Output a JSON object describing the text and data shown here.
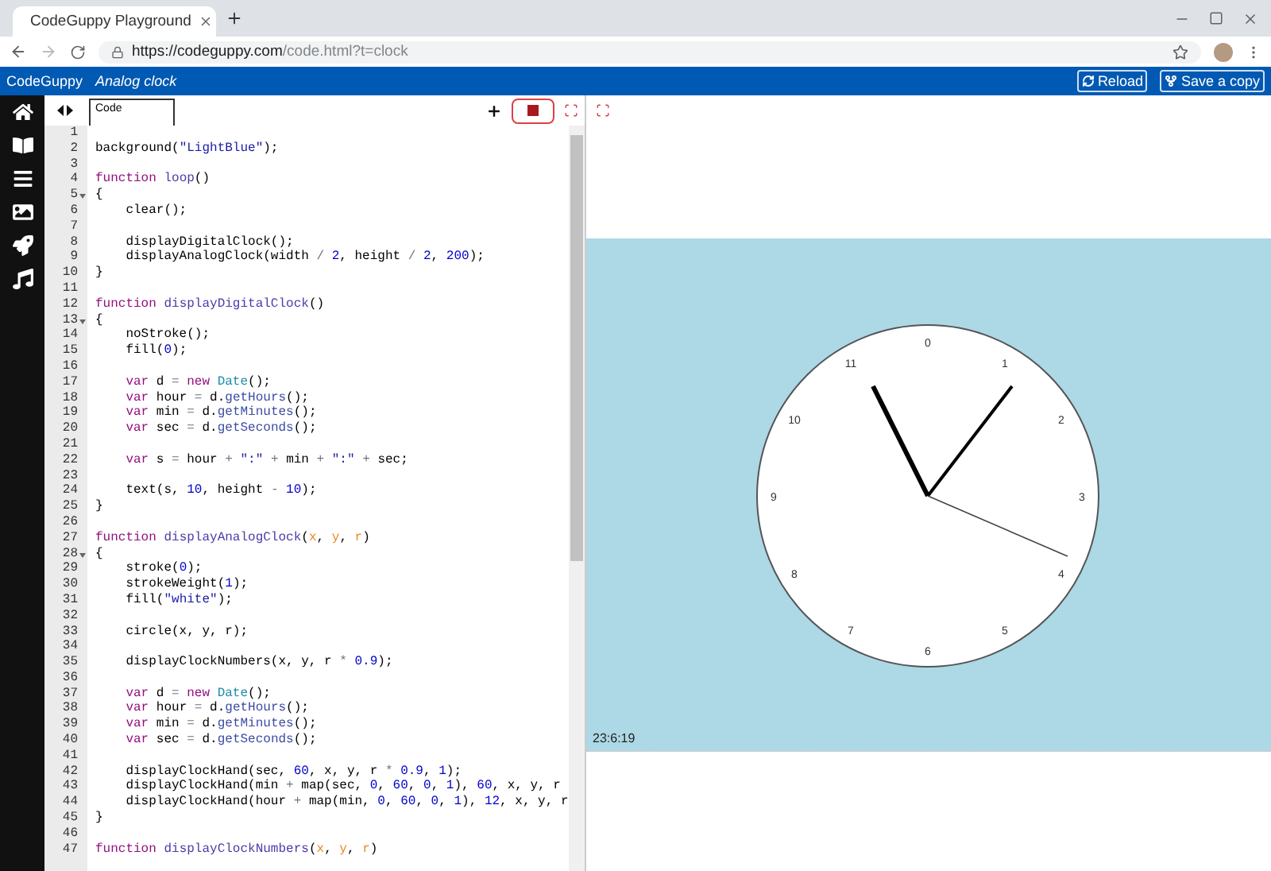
{
  "browser": {
    "tab": {
      "title": "CodeGuppy Playground"
    },
    "url": {
      "host": "https://codeguppy.com",
      "path": "/code.html?t=clock"
    }
  },
  "app_bar": {
    "brand": "CodeGuppy",
    "project": "Analog clock",
    "buttons": [
      {
        "label": "Reload",
        "kind": "reload"
      },
      {
        "label": "Save a copy",
        "kind": "fork"
      }
    ]
  },
  "sidebar": {
    "items": [
      {
        "kind": "home"
      },
      {
        "kind": "book"
      },
      {
        "kind": "list"
      },
      {
        "kind": "image"
      },
      {
        "kind": "rocket"
      },
      {
        "kind": "music"
      }
    ]
  },
  "editor": {
    "tabs": [
      {
        "label": "Code",
        "selected": true
      }
    ],
    "running": true,
    "lines": [
      {
        "n": "1",
        "fold": false
      },
      {
        "n": "2",
        "fold": false,
        "indented": false,
        "tokens": [
          {
            "kind": "plain",
            "text": "background("
          },
          {
            "kind": "string",
            "text": "\"LightBlue\""
          },
          {
            "kind": "plain",
            "text": ");"
          }
        ]
      },
      {
        "n": "3",
        "fold": false
      },
      {
        "n": "4",
        "fold": false,
        "indented": false,
        "tokens": [
          {
            "kind": "keyword",
            "text": "function "
          },
          {
            "kind": "def",
            "text": "loop"
          },
          {
            "kind": "plain",
            "text": "()"
          }
        ]
      },
      {
        "n": "5",
        "fold": true,
        "indented": false,
        "tokens": [
          {
            "kind": "plain",
            "text": "{"
          }
        ]
      },
      {
        "n": "6",
        "fold": false,
        "indented": true,
        "tokens": [
          {
            "kind": "plain",
            "text": "clear();"
          }
        ]
      },
      {
        "n": "7",
        "fold": false
      },
      {
        "n": "8",
        "fold": false,
        "indented": true,
        "tokens": [
          {
            "kind": "plain",
            "text": "displayDigitalClock();"
          }
        ]
      },
      {
        "n": "9",
        "fold": false,
        "indented": true,
        "tokens": [
          {
            "kind": "plain",
            "text": "displayAnalogClock(width "
          },
          {
            "kind": "operator",
            "text": "/ "
          },
          {
            "kind": "number",
            "text": "2"
          },
          {
            "kind": "plain",
            "text": ", height "
          },
          {
            "kind": "operator",
            "text": "/ "
          },
          {
            "kind": "number",
            "text": "2"
          },
          {
            "kind": "plain",
            "text": ", "
          },
          {
            "kind": "number",
            "text": "200"
          },
          {
            "kind": "plain",
            "text": ");"
          }
        ]
      },
      {
        "n": "10",
        "fold": false,
        "indented": false,
        "tokens": [
          {
            "kind": "plain",
            "text": "}"
          }
        ]
      },
      {
        "n": "11",
        "fold": false
      },
      {
        "n": "12",
        "fold": false,
        "indented": false,
        "tokens": [
          {
            "kind": "keyword",
            "text": "function "
          },
          {
            "kind": "def",
            "text": "displayDigitalClock"
          },
          {
            "kind": "plain",
            "text": "()"
          }
        ]
      },
      {
        "n": "13",
        "fold": true,
        "indented": false,
        "tokens": [
          {
            "kind": "plain",
            "text": "{"
          }
        ]
      },
      {
        "n": "14",
        "fold": false,
        "indented": true,
        "tokens": [
          {
            "kind": "plain",
            "text": "noStroke();"
          }
        ]
      },
      {
        "n": "15",
        "fold": false,
        "indented": true,
        "tokens": [
          {
            "kind": "plain",
            "text": "fill("
          },
          {
            "kind": "number",
            "text": "0"
          },
          {
            "kind": "plain",
            "text": ");"
          }
        ]
      },
      {
        "n": "16",
        "fold": false
      },
      {
        "n": "17",
        "fold": false,
        "indented": true,
        "tokens": [
          {
            "kind": "keyword",
            "text": "var"
          },
          {
            "kind": "plain",
            "text": " d "
          },
          {
            "kind": "operator",
            "text": "= "
          },
          {
            "kind": "keyword",
            "text": "new "
          },
          {
            "kind": "type",
            "text": "Date"
          },
          {
            "kind": "plain",
            "text": "();"
          }
        ]
      },
      {
        "n": "18",
        "fold": false,
        "indented": true,
        "tokens": [
          {
            "kind": "keyword",
            "text": "var"
          },
          {
            "kind": "plain",
            "text": " hour "
          },
          {
            "kind": "operator",
            "text": "="
          },
          {
            "kind": "plain",
            "text": " d."
          },
          {
            "kind": "method",
            "text": "getHours"
          },
          {
            "kind": "plain",
            "text": "();"
          }
        ]
      },
      {
        "n": "19",
        "fold": false,
        "indented": true,
        "tokens": [
          {
            "kind": "keyword",
            "text": "var"
          },
          {
            "kind": "plain",
            "text": " min "
          },
          {
            "kind": "operator",
            "text": "="
          },
          {
            "kind": "plain",
            "text": " d."
          },
          {
            "kind": "method",
            "text": "getMinutes"
          },
          {
            "kind": "plain",
            "text": "();"
          }
        ]
      },
      {
        "n": "20",
        "fold": false,
        "indented": true,
        "tokens": [
          {
            "kind": "keyword",
            "text": "var"
          },
          {
            "kind": "plain",
            "text": " sec "
          },
          {
            "kind": "operator",
            "text": "="
          },
          {
            "kind": "plain",
            "text": " d."
          },
          {
            "kind": "method",
            "text": "getSeconds"
          },
          {
            "kind": "plain",
            "text": "();"
          }
        ]
      },
      {
        "n": "21",
        "fold": false
      },
      {
        "n": "22",
        "fold": false,
        "indented": true,
        "tokens": [
          {
            "kind": "keyword",
            "text": "var"
          },
          {
            "kind": "plain",
            "text": " s "
          },
          {
            "kind": "operator",
            "text": "="
          },
          {
            "kind": "plain",
            "text": " hour "
          },
          {
            "kind": "operator",
            "text": "+ "
          },
          {
            "kind": "string",
            "text": "\":\""
          },
          {
            "kind": "operator",
            "text": " + "
          },
          {
            "kind": "plain",
            "text": "min "
          },
          {
            "kind": "operator",
            "text": "+ "
          },
          {
            "kind": "string",
            "text": "\":\""
          },
          {
            "kind": "operator",
            "text": " + "
          },
          {
            "kind": "plain",
            "text": "sec;"
          }
        ]
      },
      {
        "n": "23",
        "fold": false
      },
      {
        "n": "24",
        "fold": false,
        "indented": true,
        "tokens": [
          {
            "kind": "plain",
            "text": "text(s, "
          },
          {
            "kind": "number",
            "text": "10"
          },
          {
            "kind": "plain",
            "text": ", height "
          },
          {
            "kind": "operator",
            "text": "- "
          },
          {
            "kind": "number",
            "text": "10"
          },
          {
            "kind": "plain",
            "text": ");"
          }
        ]
      },
      {
        "n": "25",
        "fold": false,
        "indented": false,
        "tokens": [
          {
            "kind": "plain",
            "text": "}"
          }
        ]
      },
      {
        "n": "26",
        "fold": false
      },
      {
        "n": "27",
        "fold": false,
        "indented": false,
        "tokens": [
          {
            "kind": "keyword",
            "text": "function "
          },
          {
            "kind": "def",
            "text": "displayAnalogClock"
          },
          {
            "kind": "plain",
            "text": "("
          },
          {
            "kind": "param",
            "text": "x"
          },
          {
            "kind": "plain",
            "text": ", "
          },
          {
            "kind": "param",
            "text": "y"
          },
          {
            "kind": "plain",
            "text": ", "
          },
          {
            "kind": "param",
            "text": "r"
          },
          {
            "kind": "plain",
            "text": ")"
          }
        ]
      },
      {
        "n": "28",
        "fold": true,
        "indented": false,
        "tokens": [
          {
            "kind": "plain",
            "text": "{"
          }
        ]
      },
      {
        "n": "29",
        "fold": false,
        "indented": true,
        "tokens": [
          {
            "kind": "plain",
            "text": "stroke("
          },
          {
            "kind": "number",
            "text": "0"
          },
          {
            "kind": "plain",
            "text": ");"
          }
        ]
      },
      {
        "n": "30",
        "fold": false,
        "indented": true,
        "tokens": [
          {
            "kind": "plain",
            "text": "strokeWeight("
          },
          {
            "kind": "number",
            "text": "1"
          },
          {
            "kind": "plain",
            "text": ");"
          }
        ]
      },
      {
        "n": "31",
        "fold": false,
        "indented": true,
        "tokens": [
          {
            "kind": "plain",
            "text": "fill("
          },
          {
            "kind": "string",
            "text": "\"white\""
          },
          {
            "kind": "plain",
            "text": ");"
          }
        ]
      },
      {
        "n": "32",
        "fold": false
      },
      {
        "n": "33",
        "fold": false,
        "indented": true,
        "tokens": [
          {
            "kind": "plain",
            "text": "circle(x, y, r);"
          }
        ]
      },
      {
        "n": "34",
        "fold": false
      },
      {
        "n": "35",
        "fold": false,
        "indented": true,
        "tokens": [
          {
            "kind": "plain",
            "text": "displayClockNumbers(x, y, r "
          },
          {
            "kind": "operator",
            "text": "* "
          },
          {
            "kind": "number",
            "text": "0.9"
          },
          {
            "kind": "plain",
            "text": ");"
          }
        ]
      },
      {
        "n": "36",
        "fold": false
      },
      {
        "n": "37",
        "fold": false,
        "indented": true,
        "tokens": [
          {
            "kind": "keyword",
            "text": "var"
          },
          {
            "kind": "plain",
            "text": " d "
          },
          {
            "kind": "operator",
            "text": "= "
          },
          {
            "kind": "keyword",
            "text": "new "
          },
          {
            "kind": "type",
            "text": "Date"
          },
          {
            "kind": "plain",
            "text": "();"
          }
        ]
      },
      {
        "n": "38",
        "fold": false,
        "indented": true,
        "tokens": [
          {
            "kind": "keyword",
            "text": "var"
          },
          {
            "kind": "plain",
            "text": " hour "
          },
          {
            "kind": "operator",
            "text": "="
          },
          {
            "kind": "plain",
            "text": " d."
          },
          {
            "kind": "method",
            "text": "getHours"
          },
          {
            "kind": "plain",
            "text": "();"
          }
        ]
      },
      {
        "n": "39",
        "fold": false,
        "indented": true,
        "tokens": [
          {
            "kind": "keyword",
            "text": "var"
          },
          {
            "kind": "plain",
            "text": " min "
          },
          {
            "kind": "operator",
            "text": "="
          },
          {
            "kind": "plain",
            "text": " d."
          },
          {
            "kind": "method",
            "text": "getMinutes"
          },
          {
            "kind": "plain",
            "text": "();"
          }
        ]
      },
      {
        "n": "40",
        "fold": false,
        "indented": true,
        "tokens": [
          {
            "kind": "keyword",
            "text": "var"
          },
          {
            "kind": "plain",
            "text": " sec "
          },
          {
            "kind": "operator",
            "text": "="
          },
          {
            "kind": "plain",
            "text": " d."
          },
          {
            "kind": "method",
            "text": "getSeconds"
          },
          {
            "kind": "plain",
            "text": "();"
          }
        ]
      },
      {
        "n": "41",
        "fold": false
      },
      {
        "n": "42",
        "fold": false,
        "indented": true,
        "tokens": [
          {
            "kind": "plain",
            "text": "displayClockHand(sec, "
          },
          {
            "kind": "number",
            "text": "60"
          },
          {
            "kind": "plain",
            "text": ", x, y, r "
          },
          {
            "kind": "operator",
            "text": "* "
          },
          {
            "kind": "number",
            "text": "0.9"
          },
          {
            "kind": "plain",
            "text": ", "
          },
          {
            "kind": "number",
            "text": "1"
          },
          {
            "kind": "plain",
            "text": ");"
          }
        ]
      },
      {
        "n": "43",
        "fold": false,
        "indented": true,
        "tokens": [
          {
            "kind": "plain",
            "text": "displayClockHand(min "
          },
          {
            "kind": "operator",
            "text": "+ "
          },
          {
            "kind": "plain",
            "text": "map(sec, "
          },
          {
            "kind": "number",
            "text": "0"
          },
          {
            "kind": "plain",
            "text": ", "
          },
          {
            "kind": "number",
            "text": "60"
          },
          {
            "kind": "plain",
            "text": ", "
          },
          {
            "kind": "number",
            "text": "0"
          },
          {
            "kind": "plain",
            "text": ", "
          },
          {
            "kind": "number",
            "text": "1"
          },
          {
            "kind": "plain",
            "text": "), "
          },
          {
            "kind": "number",
            "text": "60"
          },
          {
            "kind": "plain",
            "text": ", x, y, r"
          }
        ]
      },
      {
        "n": "44",
        "fold": false,
        "indented": true,
        "tokens": [
          {
            "kind": "plain",
            "text": "displayClockHand(hour "
          },
          {
            "kind": "operator",
            "text": "+ "
          },
          {
            "kind": "plain",
            "text": "map(min, "
          },
          {
            "kind": "number",
            "text": "0"
          },
          {
            "kind": "plain",
            "text": ", "
          },
          {
            "kind": "number",
            "text": "60"
          },
          {
            "kind": "plain",
            "text": ", "
          },
          {
            "kind": "number",
            "text": "0"
          },
          {
            "kind": "plain",
            "text": ", "
          },
          {
            "kind": "number",
            "text": "1"
          },
          {
            "kind": "plain",
            "text": "), "
          },
          {
            "kind": "number",
            "text": "12"
          },
          {
            "kind": "plain",
            "text": ", x, y, r"
          }
        ]
      },
      {
        "n": "45",
        "fold": false,
        "indented": false,
        "tokens": [
          {
            "kind": "plain",
            "text": "}"
          }
        ]
      },
      {
        "n": "46",
        "fold": false
      },
      {
        "n": "47",
        "fold": false,
        "indented": false,
        "tokens": [
          {
            "kind": "keyword",
            "text": "function "
          },
          {
            "kind": "def",
            "text": "displayClockNumbers"
          },
          {
            "kind": "plain",
            "text": "("
          },
          {
            "kind": "param",
            "text": "x"
          },
          {
            "kind": "plain",
            "text": ", "
          },
          {
            "kind": "param",
            "text": "y"
          },
          {
            "kind": "plain",
            "text": ", "
          },
          {
            "kind": "param",
            "text": "r"
          },
          {
            "kind": "plain",
            "text": ")"
          }
        ]
      }
    ]
  },
  "output": {
    "clock_numbers": [
      "0",
      "1",
      "2",
      "3",
      "4",
      "5",
      "6",
      "7",
      "8",
      "9",
      "10",
      "11"
    ],
    "time": "23:6:19"
  }
}
